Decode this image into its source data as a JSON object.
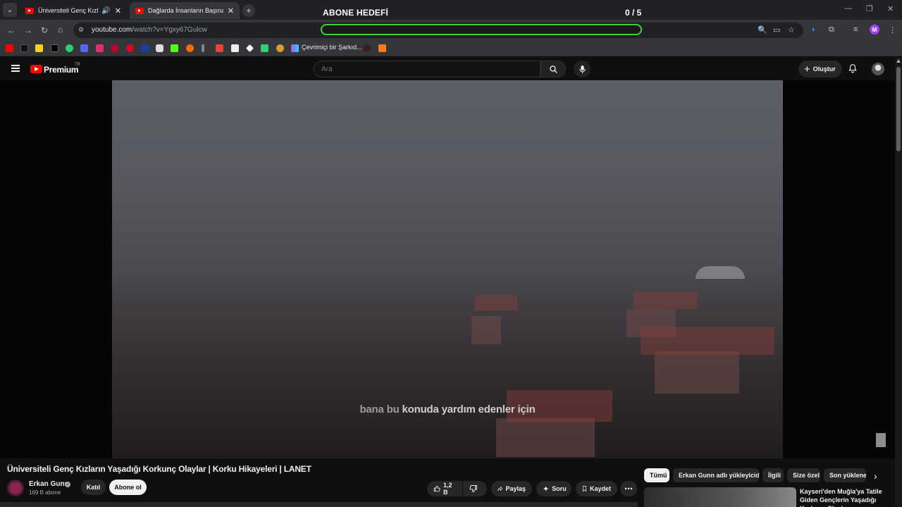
{
  "browser": {
    "tabs": [
      {
        "title": "Üniversiteli Genç Kızların Yaşadığı Korkunç Olaylar",
        "active": false,
        "playing_audio": true
      },
      {
        "title": "Dağlarda İnsanların Başına Gelen",
        "active": true,
        "playing_audio": false
      }
    ],
    "overlay": {
      "goal_label": "ABONE HEDEFİ",
      "goal_count": "0 / 5",
      "progress_fraction": 0
    },
    "url": {
      "host": "youtube.com",
      "path": "/watch?v=Ygxy67Gulcw"
    },
    "bookmark_label": "Çevrimiçi bir Şarkıd..."
  },
  "youtube": {
    "brand": "Premium",
    "region": "TR",
    "search_placeholder": "Ara",
    "create_label": "Oluştur",
    "video": {
      "subtitle_highlight": "bana bu",
      "subtitle_rest": " konuda yardım edenler için",
      "title": "Üniversiteli Genç Kızların Yaşadığı Korkunç Olaylar | Korku Hikayeleri | LANET"
    },
    "channel": {
      "name": "Erkan Gunn",
      "subscribers": "169 B abone",
      "join_label": "Katıl",
      "subscribe_label": "Abone ol"
    },
    "actions": {
      "likes": "1,2 B",
      "share": "Paylaş",
      "ask": "Soru",
      "save": "Kaydet"
    },
    "chips": [
      "Tümü",
      "Erkan Gunn adlı yükleyiciden",
      "İlgili",
      "Size özel",
      "Son yüklenenler"
    ],
    "recommendation": {
      "title": "Kayseri'den Muğla'ya Tatile Giden Gençlerin Yaşadığı Korkunç Olaylar"
    },
    "colors": {
      "accent": "#ff0000",
      "progress": "#39d72e",
      "background": "#0f0f0f"
    }
  }
}
